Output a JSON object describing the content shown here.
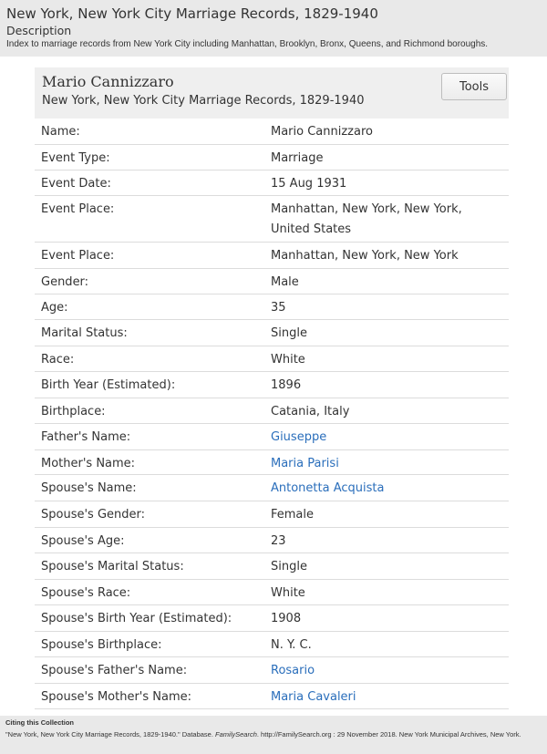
{
  "collection": {
    "title": "New York, New York City Marriage Records, 1829-1940",
    "description_heading": "Description",
    "description": "Index to marriage records from New York City including Manhattan, Brooklyn, Bronx, Queens, and Richmond boroughs."
  },
  "record": {
    "name": "Mario Cannizzaro",
    "collection": "New York, New York City Marriage Records, 1829-1940",
    "tools_label": "Tools"
  },
  "fields": [
    {
      "label": "Name:",
      "value": "Mario Cannizzaro",
      "link": false
    },
    {
      "label": "Event Type:",
      "value": "Marriage",
      "link": false
    },
    {
      "label": "Event Date:",
      "value": "15 Aug 1931",
      "link": false
    },
    {
      "label": "Event Place:",
      "value": "Manhattan, New York, New York, United States",
      "link": false
    },
    {
      "label": "Event Place:",
      "value": "Manhattan, New York, New York",
      "link": false
    },
    {
      "label": "Gender:",
      "value": "Male",
      "link": false
    },
    {
      "label": "Age:",
      "value": "35",
      "link": false
    },
    {
      "label": "Marital Status:",
      "value": "Single",
      "link": false
    },
    {
      "label": "Race:",
      "value": "White",
      "link": false
    },
    {
      "label": "Birth Year (Estimated):",
      "value": "1896",
      "link": false
    },
    {
      "label": "Birthplace:",
      "value": "Catania, Italy",
      "link": false
    },
    {
      "label": "Father's Name:",
      "value": "Giuseppe",
      "link": true
    },
    {
      "label": "Mother's Name:",
      "value": "Maria Parisi",
      "link": true
    },
    {
      "label": "Spouse's Name:",
      "value": "Antonetta Acquista",
      "link": true
    },
    {
      "label": "Spouse's Gender:",
      "value": "Female",
      "link": false
    },
    {
      "label": "Spouse's Age:",
      "value": "23",
      "link": false
    },
    {
      "label": "Spouse's Marital Status:",
      "value": "Single",
      "link": false
    },
    {
      "label": "Spouse's Race:",
      "value": "White",
      "link": false
    },
    {
      "label": "Spouse's Birth Year (Estimated):",
      "value": "1908",
      "link": false
    },
    {
      "label": "Spouse's Birthplace:",
      "value": "N. Y. C.",
      "link": false
    },
    {
      "label": "Spouse's Father's Name:",
      "value": "Rosario",
      "link": true
    },
    {
      "label": "Spouse's Mother's Name:",
      "value": "Maria Cavaleri",
      "link": true
    }
  ],
  "citation": {
    "heading": "Citing this Collection",
    "text": "\"New York, New York City Marriage Records, 1829-1940.\" Database. FamilySearch. http://FamilySearch.org : 29 November 2018. New York Municipal Archives, New York."
  }
}
